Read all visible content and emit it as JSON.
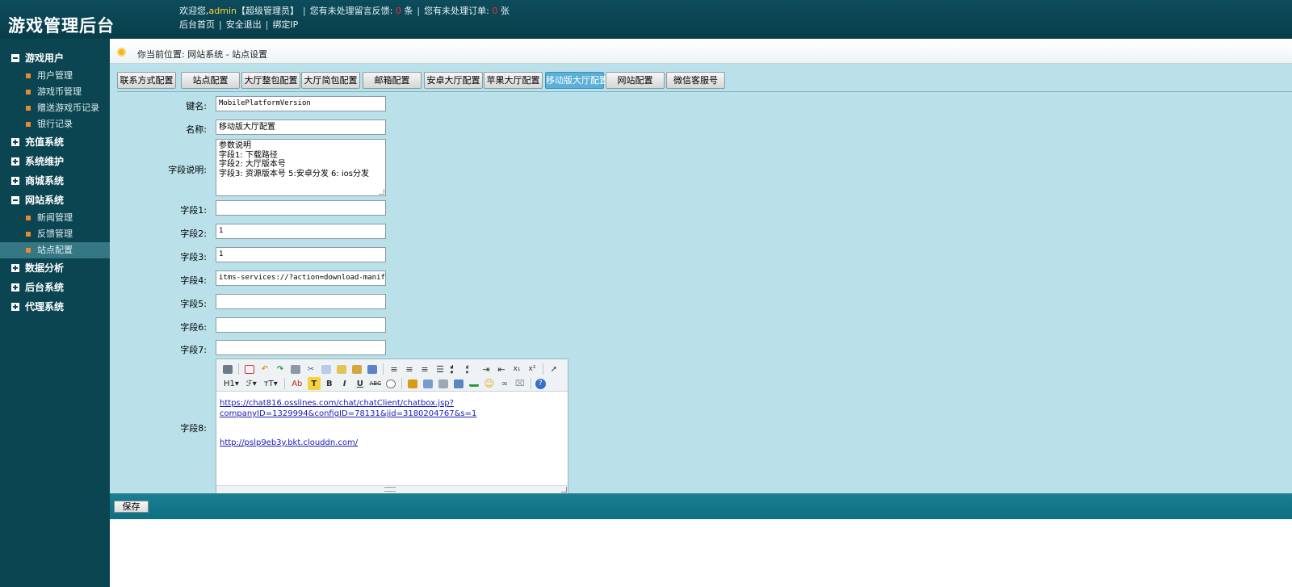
{
  "header": {
    "title": "游戏管理后台",
    "welcome": "欢迎您,",
    "username": "admin",
    "role": "【超级管理员】",
    "feedback_prefix": "您有未处理留言反馈:",
    "feedback_count": "0",
    "feedback_unit": "条",
    "orders_prefix": "您有未处理订单:",
    "orders_count": "0",
    "orders_unit": "张",
    "links": [
      "后台首页",
      "安全退出",
      "绑定IP"
    ]
  },
  "sidebar": {
    "groups": [
      {
        "label": "游戏用户",
        "expanded": true,
        "items": [
          "用户管理",
          "游戏币管理",
          "赠送游戏币记录",
          "银行记录"
        ]
      },
      {
        "label": "充值系统",
        "expanded": false,
        "items": []
      },
      {
        "label": "系统维护",
        "expanded": false,
        "items": []
      },
      {
        "label": "商城系统",
        "expanded": false,
        "items": []
      },
      {
        "label": "网站系统",
        "expanded": true,
        "items": [
          "新闻管理",
          "反馈管理",
          "站点配置"
        ]
      },
      {
        "label": "数据分析",
        "expanded": false,
        "items": []
      },
      {
        "label": "后台系统",
        "expanded": false,
        "items": []
      },
      {
        "label": "代理系统",
        "expanded": false,
        "items": []
      }
    ],
    "active_item": "站点配置"
  },
  "breadcrumb": {
    "text": "你当前位置: 网站系统 - 站点设置"
  },
  "tabs": {
    "items": [
      "联系方式配置",
      "站点配置",
      "大厅整包配置",
      "大厅简包配置",
      "邮箱配置",
      "安卓大厅配置",
      "苹果大厅配置",
      "移动版大厅配置",
      "网站配置",
      "微信客服号"
    ],
    "active": "移动版大厅配置"
  },
  "form": {
    "key_label": "键名:",
    "key_value": "MobilePlatformVersion",
    "name_label": "名称:",
    "name_value": "移动版大厅配置",
    "desc_label": "字段说明:",
    "desc_lines": [
      "参数说明",
      "字段1: 下载路径",
      "字段2: 大厅版本号",
      "字段3: 资源版本号 5:安卓分发 6: ios分发"
    ],
    "fields": [
      {
        "label": "字段1:",
        "value": ""
      },
      {
        "label": "字段2:",
        "value": "1"
      },
      {
        "label": "字段3:",
        "value": "1"
      },
      {
        "label": "字段4:",
        "value": "itms-services://?action=download-manifest&"
      },
      {
        "label": "字段5:",
        "value": ""
      },
      {
        "label": "字段6:",
        "value": ""
      },
      {
        "label": "字段7:",
        "value": ""
      }
    ],
    "field8_label": "字段8:",
    "editor": {
      "link1_line1": "https://chat816.osslines.com/chat/chatClient/chatbox.jsp?",
      "link1_line2": "companyID=1329994&configID=78131&jid=3180204767&s=1",
      "link2": "http://pslp9eb3y.bkt.clouddn.com/",
      "toolbar_labels": {
        "heading": "H1",
        "font": "ℱ",
        "size": "ᴛT",
        "font_color": "Ab",
        "bg_color": "T",
        "bold": "B",
        "italic": "I",
        "underline": "U",
        "strike": "ABC"
      }
    }
  },
  "footer": {
    "save_label": "保存"
  },
  "colors": {
    "header_bg": "#0d4c5c",
    "sidebar_bg": "#0c4552",
    "main_bg": "#bae1ea",
    "active_tab": "#5bb0d8",
    "bottom_bar": "#1b7f92"
  }
}
